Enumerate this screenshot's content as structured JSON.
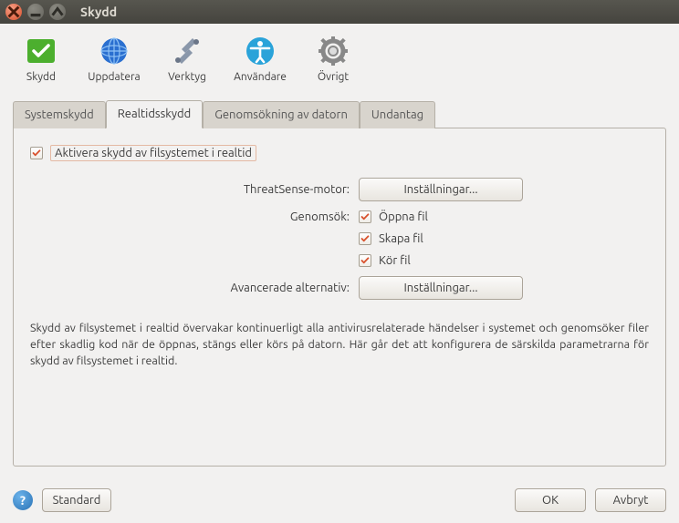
{
  "window": {
    "title": "Skydd"
  },
  "toolbar": {
    "skydd": "Skydd",
    "uppdatera": "Uppdatera",
    "verktyg": "Verktyg",
    "anvandare": "Användare",
    "ovrigt": "Övrigt"
  },
  "tabs": {
    "systemskydd": "Systemskydd",
    "realtidsskydd": "Realtidsskydd",
    "genomsok": "Genomsökning av datorn",
    "undantag": "Undantag"
  },
  "panel": {
    "aktivera": "Aktivera skydd av filsystemet i realtid",
    "threatsense_label": "ThreatSense-motor:",
    "genomsok_label": "Genomsök:",
    "open_file": "Öppna fil",
    "create_file": "Skapa fil",
    "run_file": "Kör fil",
    "advanced_label": "Avancerade alternativ:",
    "settings_btn": "Inställningar...",
    "description": "Skydd av filsystemet i realtid övervakar kontinuerligt alla antivirusrelaterade händelser i systemet och genomsöker filer efter skadlig kod när de öppnas, stängs eller körs på datorn. Här går det att konfigurera de särskilda parametrarna för skydd av filsystemet i realtid."
  },
  "footer": {
    "standard": "Standard",
    "ok": "OK",
    "avbryt": "Avbryt"
  }
}
